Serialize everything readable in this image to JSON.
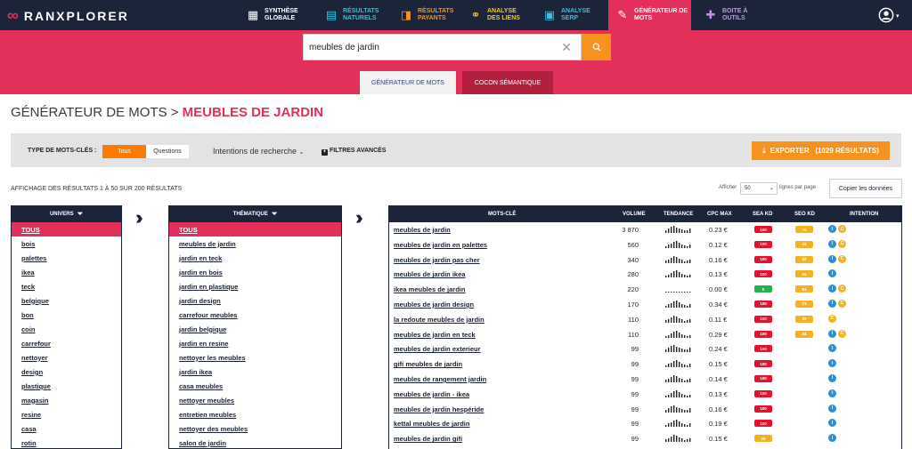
{
  "brand": {
    "name": "RANXPLORER"
  },
  "nav": [
    {
      "label": "SYNTHÈSE GLOBALE",
      "icon": "dashboard-icon",
      "color": "#ffffff",
      "active": false
    },
    {
      "label": "RÉSULTATS NATURELS",
      "icon": "chart-icon",
      "color": "#2ec4e0",
      "active": false
    },
    {
      "label": "RÉSULTATS PAYANTS",
      "icon": "paid-icon",
      "color": "#f7921e",
      "active": false
    },
    {
      "label": "ANALYSE DES LIENS",
      "icon": "link-icon",
      "color": "#f4c430",
      "active": false
    },
    {
      "label": "ANALYSE SERP",
      "icon": "serp-icon",
      "color": "#2ec4e0",
      "active": false
    },
    {
      "label": "GÉNÉRATEUR DE MOTS",
      "icon": "pencil-icon",
      "color": "#ffffff",
      "active": true
    },
    {
      "label": "BOITE À OUTILS",
      "icon": "tools-icon",
      "color": "#c88fe8",
      "active": false
    }
  ],
  "search": {
    "value": "meubles de jardin"
  },
  "tabs": [
    {
      "label": "GÉNÉRATEUR DE MOTS"
    },
    {
      "label": "COCON SÉMANTIQUE"
    }
  ],
  "page": {
    "title_prefix": "GÉNÉRATEUR DE MOTS > ",
    "title_main": "MEUBLES DE JARDIN"
  },
  "filters": {
    "type_label": "TYPE DE MOTS-CLÉS :",
    "tous": "Tous",
    "questions": "Questions",
    "intentions": "Intentions de recherche",
    "advanced": "FILTRES AVANCÉS"
  },
  "export_label": "EXPORTER   (1029 RÉSULTATS)",
  "results_info": "AFFICHAGE DES RÉSULTATS 1 À 50 SUR 200 RÉSULTATS",
  "lines": {
    "afficher": "Afficher",
    "value": "50",
    "suffix": "lignes par page"
  },
  "copy_label": "Copier les données",
  "univers": {
    "header": "UNIVERS",
    "items": [
      "TOUS",
      "bois",
      "palettes",
      "ikea",
      "teck",
      "belgique",
      "bon",
      "coin",
      "carrefour",
      "nettoyer",
      "design",
      "plastique",
      "magasin",
      "resine",
      "casa",
      "rotin"
    ]
  },
  "thematique": {
    "header": "THÉMATIQUE",
    "items": [
      "TOUS",
      "meubles de jardin",
      "jardin en teck",
      "jardin en bois",
      "jardin en plastique",
      "jardin design",
      "carrefour meubles",
      "jardin belgique",
      "jardin en resine",
      "nettoyer les meubles",
      "jardin ikea",
      "casa meubles",
      "nettoyer meubles",
      "entretien meubles",
      "nettoyer des meubles",
      "salon de jardin"
    ]
  },
  "keywords": {
    "headers": {
      "kw": "MOTS-CLÉ",
      "vol": "VOLUME",
      "tend": "TENDANCE",
      "cpc": "CPC MAX",
      "sea": "SEA KD",
      "seo": "SEO KD",
      "int": "INTENTION"
    },
    "rows": [
      {
        "kw": "meubles de jardin",
        "vol": "3 870",
        "cpc": "0.23 €",
        "sea": "100",
        "seo": "70",
        "intents": [
          "I",
          "C"
        ]
      },
      {
        "kw": "meubles de jardin en palettes",
        "vol": "560",
        "cpc": "0.12 €",
        "sea": "100",
        "seo": "42",
        "intents": [
          "I",
          "C"
        ]
      },
      {
        "kw": "meubles de jardin pas cher",
        "vol": "340",
        "cpc": "0.16 €",
        "sea": "100",
        "seo": "52",
        "intents": [
          "I",
          "C"
        ]
      },
      {
        "kw": "meubles de jardin ikea",
        "vol": "280",
        "cpc": "0.13 €",
        "sea": "100",
        "seo": "55",
        "intents": [
          "I"
        ]
      },
      {
        "kw": "ikea meubles de jardin",
        "vol": "220",
        "cpc": "0.00 €",
        "sea": "0",
        "seo": "51",
        "intents": [
          "I",
          "C"
        ]
      },
      {
        "kw": "meubles de jardin design",
        "vol": "170",
        "cpc": "0.34 €",
        "sea": "100",
        "seo": "71",
        "intents": [
          "I",
          "C"
        ]
      },
      {
        "kw": "la redoute meubles de jardin",
        "vol": "110",
        "cpc": "0.11 €",
        "sea": "100",
        "seo": "39",
        "intents": [
          "C"
        ]
      },
      {
        "kw": "meubles de jardin en teck",
        "vol": "110",
        "cpc": "0.29 €",
        "sea": "100",
        "seo": "44",
        "intents": [
          "I",
          "C"
        ]
      },
      {
        "kw": "meubles de jardin exterieur",
        "vol": "99",
        "cpc": "0.24 €",
        "sea": "100",
        "seo": "",
        "intents": [
          "I"
        ]
      },
      {
        "kw": "gifi meubles de jardin",
        "vol": "99",
        "cpc": "0.15 €",
        "sea": "100",
        "seo": "",
        "intents": [
          "I"
        ]
      },
      {
        "kw": "meubles de rangement jardin",
        "vol": "99",
        "cpc": "0.14 €",
        "sea": "100",
        "seo": "",
        "intents": [
          "I"
        ]
      },
      {
        "kw": "meubles de jardin - ikea",
        "vol": "99",
        "cpc": "0.13 €",
        "sea": "100",
        "seo": "",
        "intents": [
          "I"
        ]
      },
      {
        "kw": "meubles de jardin hespéride",
        "vol": "99",
        "cpc": "0.16 €",
        "sea": "100",
        "seo": "",
        "intents": [
          "I"
        ]
      },
      {
        "kw": "kettal meubles de jardin",
        "vol": "99",
        "cpc": "0.19 €",
        "sea": "100",
        "seo": "",
        "intents": [
          "I"
        ]
      },
      {
        "kw": "meubles de jardin gifi",
        "vol": "99",
        "cpc": "0.15 €",
        "sea": "26",
        "seo": "",
        "intents": [
          "I"
        ]
      }
    ]
  },
  "colors": {
    "navy": "#1b2438",
    "pink": "#e2305a",
    "orange": "#f7921e",
    "red_badge": "#e8112d",
    "green_badge": "#22b14c",
    "yellow_badge": "#f5b21e",
    "intent_i": "#2a8fd8",
    "intent_c": "#f5b21e"
  }
}
